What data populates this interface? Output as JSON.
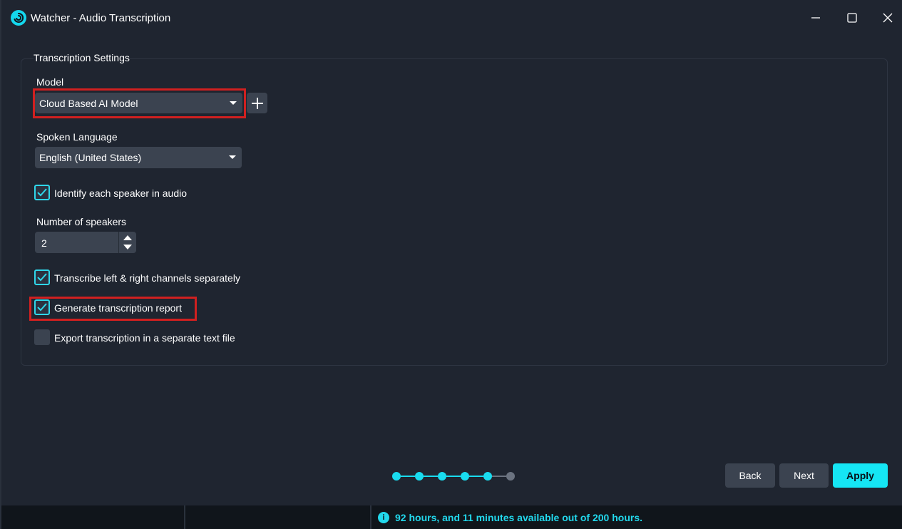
{
  "window": {
    "title": "Watcher - Audio Transcription"
  },
  "settings": {
    "group_title": "Transcription Settings",
    "model": {
      "label": "Model",
      "selected": "Cloud Based AI Model"
    },
    "language": {
      "label": "Spoken Language",
      "selected": "English (United States)"
    },
    "identify_speakers": {
      "label": "Identify each speaker in audio",
      "checked": true
    },
    "speakers": {
      "label": "Number of speakers",
      "value": "2"
    },
    "separate_channels": {
      "label": "Transcribe left & right channels separately",
      "checked": true
    },
    "generate_report": {
      "label": "Generate transcription report",
      "checked": true
    },
    "export_text": {
      "label": "Export transcription in a separate text file",
      "checked": false
    }
  },
  "stepper": {
    "total_steps": 6,
    "completed_steps": 5,
    "active_color": "#19dcef",
    "inactive_color": "#6b7380"
  },
  "buttons": {
    "back": "Back",
    "next": "Next",
    "apply": "Apply"
  },
  "status": {
    "text": "92 hours, and 11 minutes available out of 200 hours.",
    "icon": "info-icon"
  },
  "colors": {
    "accent": "#15e6f4",
    "highlight": "#d02020",
    "background": "#1f2530"
  }
}
